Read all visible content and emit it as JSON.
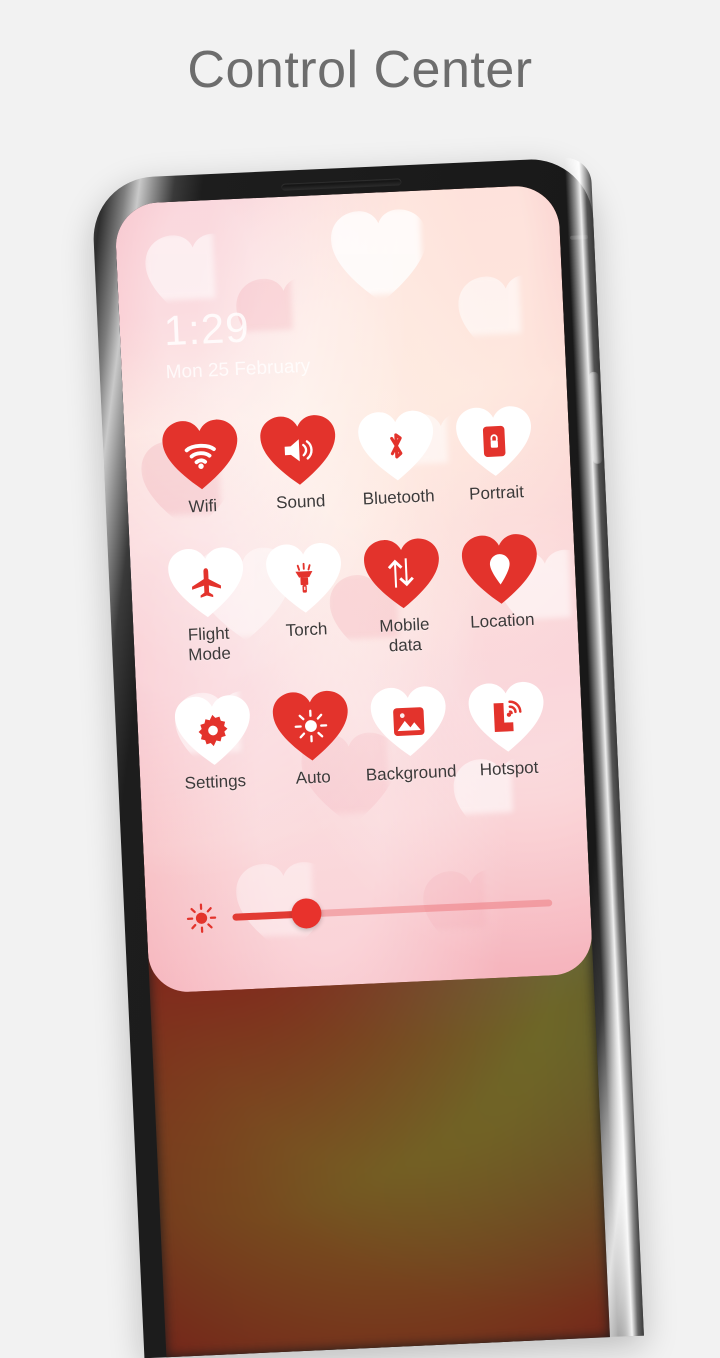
{
  "header": {
    "title": "Control Center"
  },
  "status": {
    "time": "1:29",
    "date": "Mon 25 February"
  },
  "colors": {
    "accent_red": "#e3332c",
    "heart_white": "#ffffff",
    "label_text": "#3c3a3a",
    "page_bg": "#f2f2f2",
    "title_text": "#6d6d6d",
    "panel_pink": "#f6b6bf"
  },
  "toggles": [
    {
      "label": "Wifi",
      "icon": "wifi-icon",
      "style": "filled",
      "lines": 1
    },
    {
      "label": "Sound",
      "icon": "sound-icon",
      "style": "filled",
      "lines": 1
    },
    {
      "label": "Bluetooth",
      "icon": "bluetooth-icon",
      "style": "outline",
      "lines": 1
    },
    {
      "label": "Portrait",
      "icon": "portrait-lock-icon",
      "style": "outline",
      "lines": 1
    },
    {
      "label": "Flight\nMode",
      "icon": "airplane-icon",
      "style": "outline",
      "lines": 2
    },
    {
      "label": "Torch",
      "icon": "torch-icon",
      "style": "outline",
      "lines": 1
    },
    {
      "label": "Mobile\ndata",
      "icon": "mobile-data-icon",
      "style": "filled",
      "lines": 2
    },
    {
      "label": "Location",
      "icon": "location-pin-icon",
      "style": "filled",
      "lines": 1
    },
    {
      "label": "Settings",
      "icon": "gear-icon",
      "style": "outline",
      "lines": 1
    },
    {
      "label": "Auto",
      "icon": "brightness-auto-icon",
      "style": "filled",
      "lines": 1
    },
    {
      "label": "Background",
      "icon": "image-icon",
      "style": "outline",
      "lines": 1
    },
    {
      "label": "Hotspot",
      "icon": "hotspot-icon",
      "style": "outline",
      "lines": 1
    }
  ],
  "brightness": {
    "icon": "sun-icon",
    "value_percent": 23
  }
}
